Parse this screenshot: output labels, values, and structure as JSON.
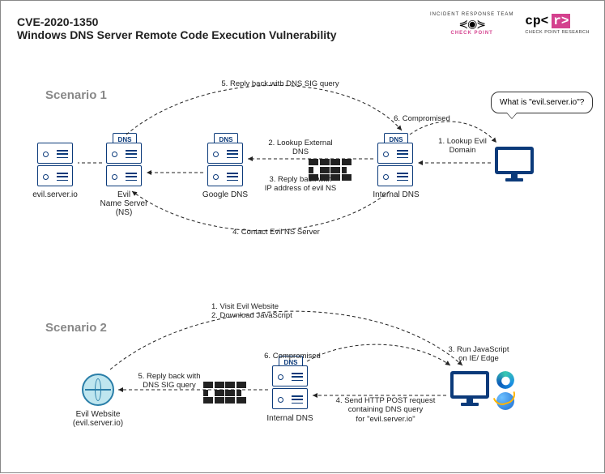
{
  "title": {
    "line1": "CVE-2020-1350",
    "line2": "Windows DNS Server Remote Code Execution Vulnerability"
  },
  "logos": {
    "irt_line1": "INCIDENT RESPONSE TEAM",
    "irt_line2": "CHECK POINT",
    "cpr_text": "cp<",
    "cpr_box": "r>",
    "cpr_sub": "CHECK POINT RESEARCH"
  },
  "scenario1": {
    "label": "Scenario 1",
    "speech": "What is \"evil.server.io\"?",
    "nodes": {
      "evil_server": "evil.server.io",
      "evil_ns": "Evil\nName Server\n(NS)",
      "google_dns": "Google DNS",
      "internal_dns": "Internal DNS",
      "dns_tag": "DNS"
    },
    "edges": {
      "e1": "1. Lookup Evil\nDomain",
      "e2": "2. Lookup External\nDNS",
      "e3": "3. Reply back with\nIP address of evil NS",
      "e4": "4. Contact Evil NS Server",
      "e5": "5. Reply back with DNS SIG query",
      "e6": "6. Compromised"
    }
  },
  "scenario2": {
    "label": "Scenario 2",
    "nodes": {
      "evil_web": "Evil Website\n(evil.server.io)",
      "internal_dns": "Internal DNS",
      "dns_tag": "DNS"
    },
    "edges": {
      "e1": "1. Visit Evil Website\n2. Download JavaScript",
      "e3": "3. Run JavaScript\non IE/ Edge",
      "e4": "4. Send HTTP POST request\ncontaining DNS query\nfor \"evil.server.io\"",
      "e5": "5. Reply back with\nDNS SIG query",
      "e6": "6. Compromised"
    }
  }
}
